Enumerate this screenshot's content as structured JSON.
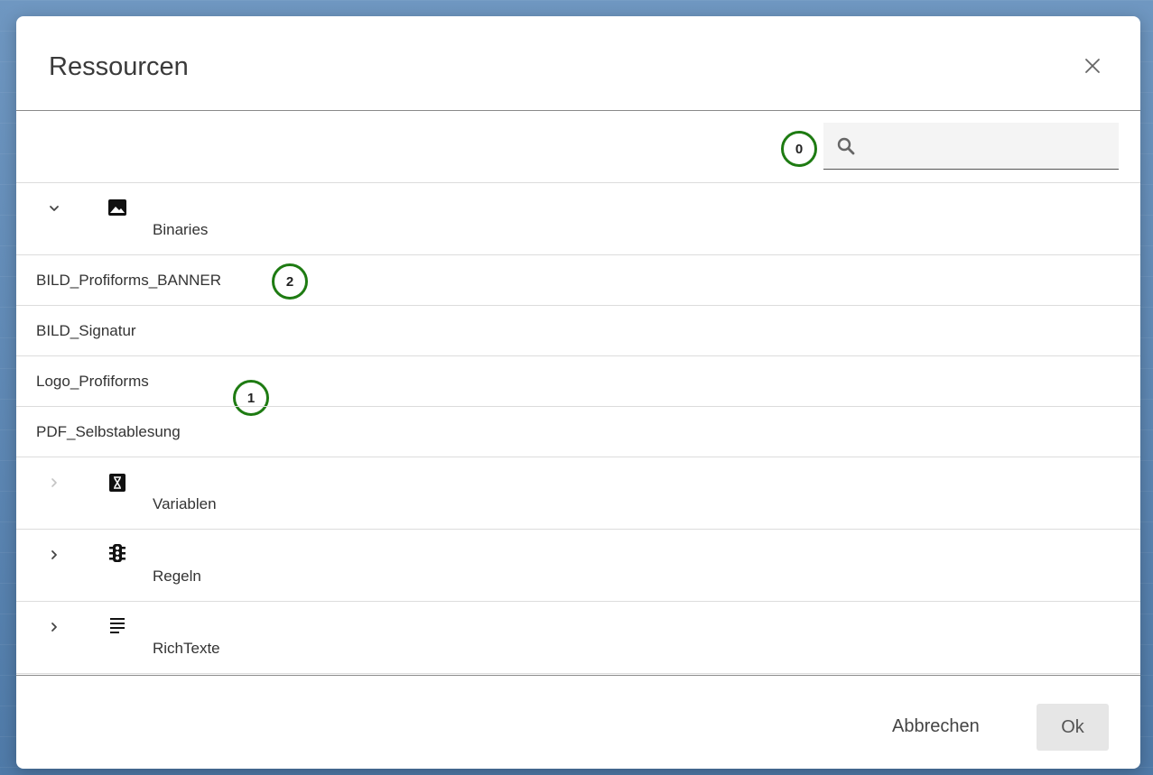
{
  "dialog": {
    "title": "Ressourcen",
    "close_icon": "close-icon"
  },
  "toolbar": {
    "search_placeholder": "",
    "search_value": "",
    "search_icon": "search-icon"
  },
  "annotations": {
    "badge_0": "0",
    "badge_1": "1",
    "badge_2": "2",
    "badge_color": "#1e7b12"
  },
  "tree": {
    "groups": [
      {
        "label": "Binaries",
        "icon": "image-icon",
        "expanded": true,
        "chevron": "chevron-down-icon"
      },
      {
        "label": "Variablen",
        "icon": "variable-icon",
        "expanded": false,
        "chevron": "chevron-right-icon",
        "disabled": true
      },
      {
        "label": "Regeln",
        "icon": "traffic-light-icon",
        "expanded": false,
        "chevron": "chevron-right-icon"
      },
      {
        "label": "RichTexte",
        "icon": "text-lines-icon",
        "expanded": false,
        "chevron": "chevron-right-icon"
      }
    ],
    "binaries_items": [
      "BILD_Profiforms_BANNER",
      "BILD_Signatur",
      "Logo_Profiforms",
      "PDF_Selbstablesung"
    ]
  },
  "footer": {
    "cancel_label": "Abbrechen",
    "ok_label": "Ok"
  }
}
